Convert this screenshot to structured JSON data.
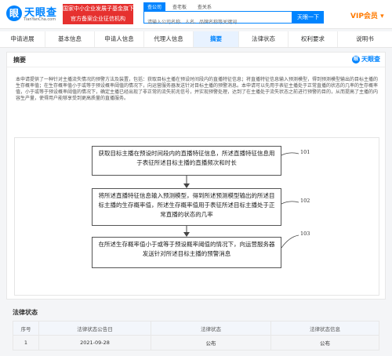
{
  "header": {
    "logo_text": "天眼查",
    "logo_url": "TianYanCha.com",
    "promo_line1": "国家中小企业发展子基金旗下",
    "promo_line2": "官方备案企业征信机构",
    "search_tabs": [
      "查公司",
      "查老板",
      "查关系"
    ],
    "search_placeholder": "请输入公司名称、人名、品牌名称等关键词",
    "search_button": "天眼一下",
    "vip_label": "VIP会员"
  },
  "nav": {
    "tabs": [
      "申请进展",
      "基本信息",
      "申请人信息",
      "代理人信息",
      "摘要",
      "法律状态",
      "权利要求",
      "说明书"
    ],
    "active": "摘要"
  },
  "abstract_section": {
    "title": "摘要",
    "watermark": "天眼查",
    "text": "本申请提供了一种针对主播流失情况的预警方法及装置，包括：获取目标主播在预设时间段内的直播特征信息；将直播特征信息输入预测模型，得到预测模型输出的目标主播的生存概率值；在生存概率值小于或等于预设概率阈值的情况下，向运营服务器发送针对目标主播的预警消息。本申请可以先用于表征主播处于正常直播的状态的几率的生存概率值，小于或等于预设概率阈值的情况下，确定主播已经出现了非正常的流失前兆信号，并实现预警处理，达到了在主播处于流失状态之前进行预警的目的，从而提高了主播的内容生产量，使得用户能够享受到更高质量的直播服务。",
    "diagram": {
      "steps": [
        {
          "text": "获取目标主播在预设时间段内的直播特征信息，所述直播特征信息用于表征所述目标主播的直播频次和时长",
          "num": "101"
        },
        {
          "text": "将所述直播特征信息输入预测模型，得到所述预测模型输出的所述目标主播的生存概率值，所述生存概率值用于表征所述目标主播处于正常直播的状态的几率",
          "num": "102"
        },
        {
          "text": "在所述生存概率值小于或等于预设概率阈值的情况下，向运营服务器发送针对所述目标主播的预警消息",
          "num": "103"
        }
      ]
    }
  },
  "legal_status": {
    "title": "法律状态",
    "columns": [
      "序号",
      "法律状态公告日",
      "法律状态",
      "法律状态信息"
    ],
    "rows": [
      [
        "1",
        "2021-09-28",
        "公布",
        "公布"
      ]
    ]
  }
}
